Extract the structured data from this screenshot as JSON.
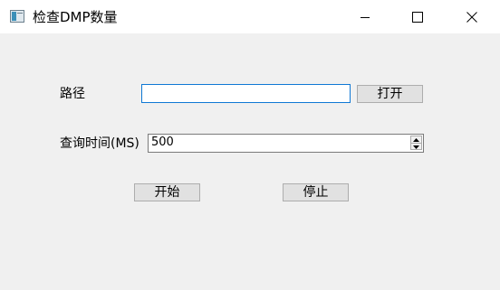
{
  "window": {
    "title": "检查DMP数量",
    "icon": "window-app-icon",
    "controls": {
      "minimize": "minimize-icon",
      "maximize": "maximize-icon",
      "close": "close-icon"
    }
  },
  "form": {
    "path_label": "路径",
    "path_value": "",
    "open_button": "打开",
    "query_time_label": "查询时间(MS)",
    "query_time_value": "500",
    "start_button": "开始",
    "stop_button": "停止"
  },
  "colors": {
    "focus_border": "#0f78d4",
    "button_bg": "#e1e1e1",
    "window_bg": "#f0f0f0"
  }
}
